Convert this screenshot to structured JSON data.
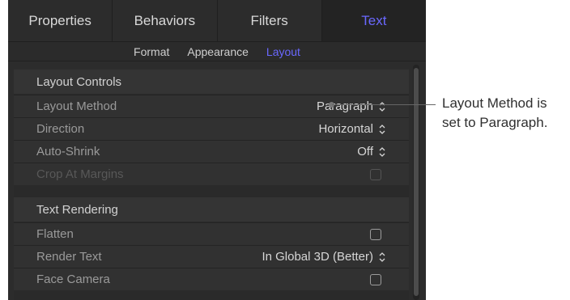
{
  "tabs": [
    {
      "label": "Properties",
      "active": false
    },
    {
      "label": "Behaviors",
      "active": false
    },
    {
      "label": "Filters",
      "active": false
    },
    {
      "label": "Text",
      "active": true
    }
  ],
  "subtabs": [
    {
      "label": "Format",
      "active": false
    },
    {
      "label": "Appearance",
      "active": false
    },
    {
      "label": "Layout",
      "active": true
    }
  ],
  "sections": [
    {
      "title": "Layout Controls",
      "rows": [
        {
          "label": "Layout Method",
          "value": "Paragraph",
          "type": "select"
        },
        {
          "label": "Direction",
          "value": "Horizontal",
          "type": "select"
        },
        {
          "label": "Auto-Shrink",
          "value": "Off",
          "type": "select"
        },
        {
          "label": "Crop At Margins",
          "value": "",
          "type": "checkbox",
          "disabled": true
        }
      ]
    },
    {
      "title": "Text Rendering",
      "rows": [
        {
          "label": "Flatten",
          "value": "",
          "type": "checkbox"
        },
        {
          "label": "Render Text",
          "value": "In Global 3D (Better)",
          "type": "select"
        },
        {
          "label": "Face Camera",
          "value": "",
          "type": "checkbox"
        }
      ]
    }
  ],
  "callout": {
    "text": "Layout Method is set to Paragraph."
  },
  "icons": {
    "select": "updown-chevron-icon",
    "checkbox": "checkbox-unchecked-icon"
  },
  "colors": {
    "accent": "#6a68ff",
    "panel": "#2c2c2c"
  }
}
